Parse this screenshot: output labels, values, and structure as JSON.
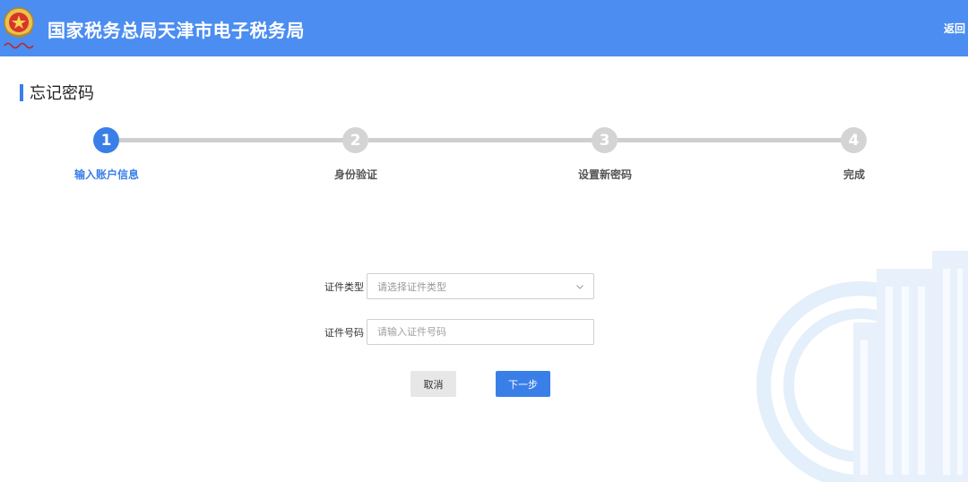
{
  "header": {
    "title": "国家税务总局天津市电子税务局",
    "back_label": "返回",
    "brand_color": "#4b8df0"
  },
  "page": {
    "heading": "忘记密码"
  },
  "steps": [
    {
      "number": "1",
      "label": "输入账户信息",
      "state": "active"
    },
    {
      "number": "2",
      "label": "身份验证",
      "state": "inactive"
    },
    {
      "number": "3",
      "label": "设置新密码",
      "state": "inactive"
    },
    {
      "number": "4",
      "label": "完成",
      "state": "inactive"
    }
  ],
  "form": {
    "id_type": {
      "label": "证件类型",
      "placeholder": "请选择证件类型",
      "value": ""
    },
    "id_number": {
      "label": "证件号码",
      "placeholder": "请输入证件号码",
      "value": ""
    }
  },
  "buttons": {
    "cancel": "取消",
    "next": "下一步"
  },
  "icons": {
    "emblem": "tax-emblem-icon",
    "select_arrow": "chevron-down-icon",
    "watermark": "tax-building-watermark-icon"
  },
  "colors": {
    "accent": "#3a7fe8",
    "step_inactive": "#d4d4d4"
  }
}
